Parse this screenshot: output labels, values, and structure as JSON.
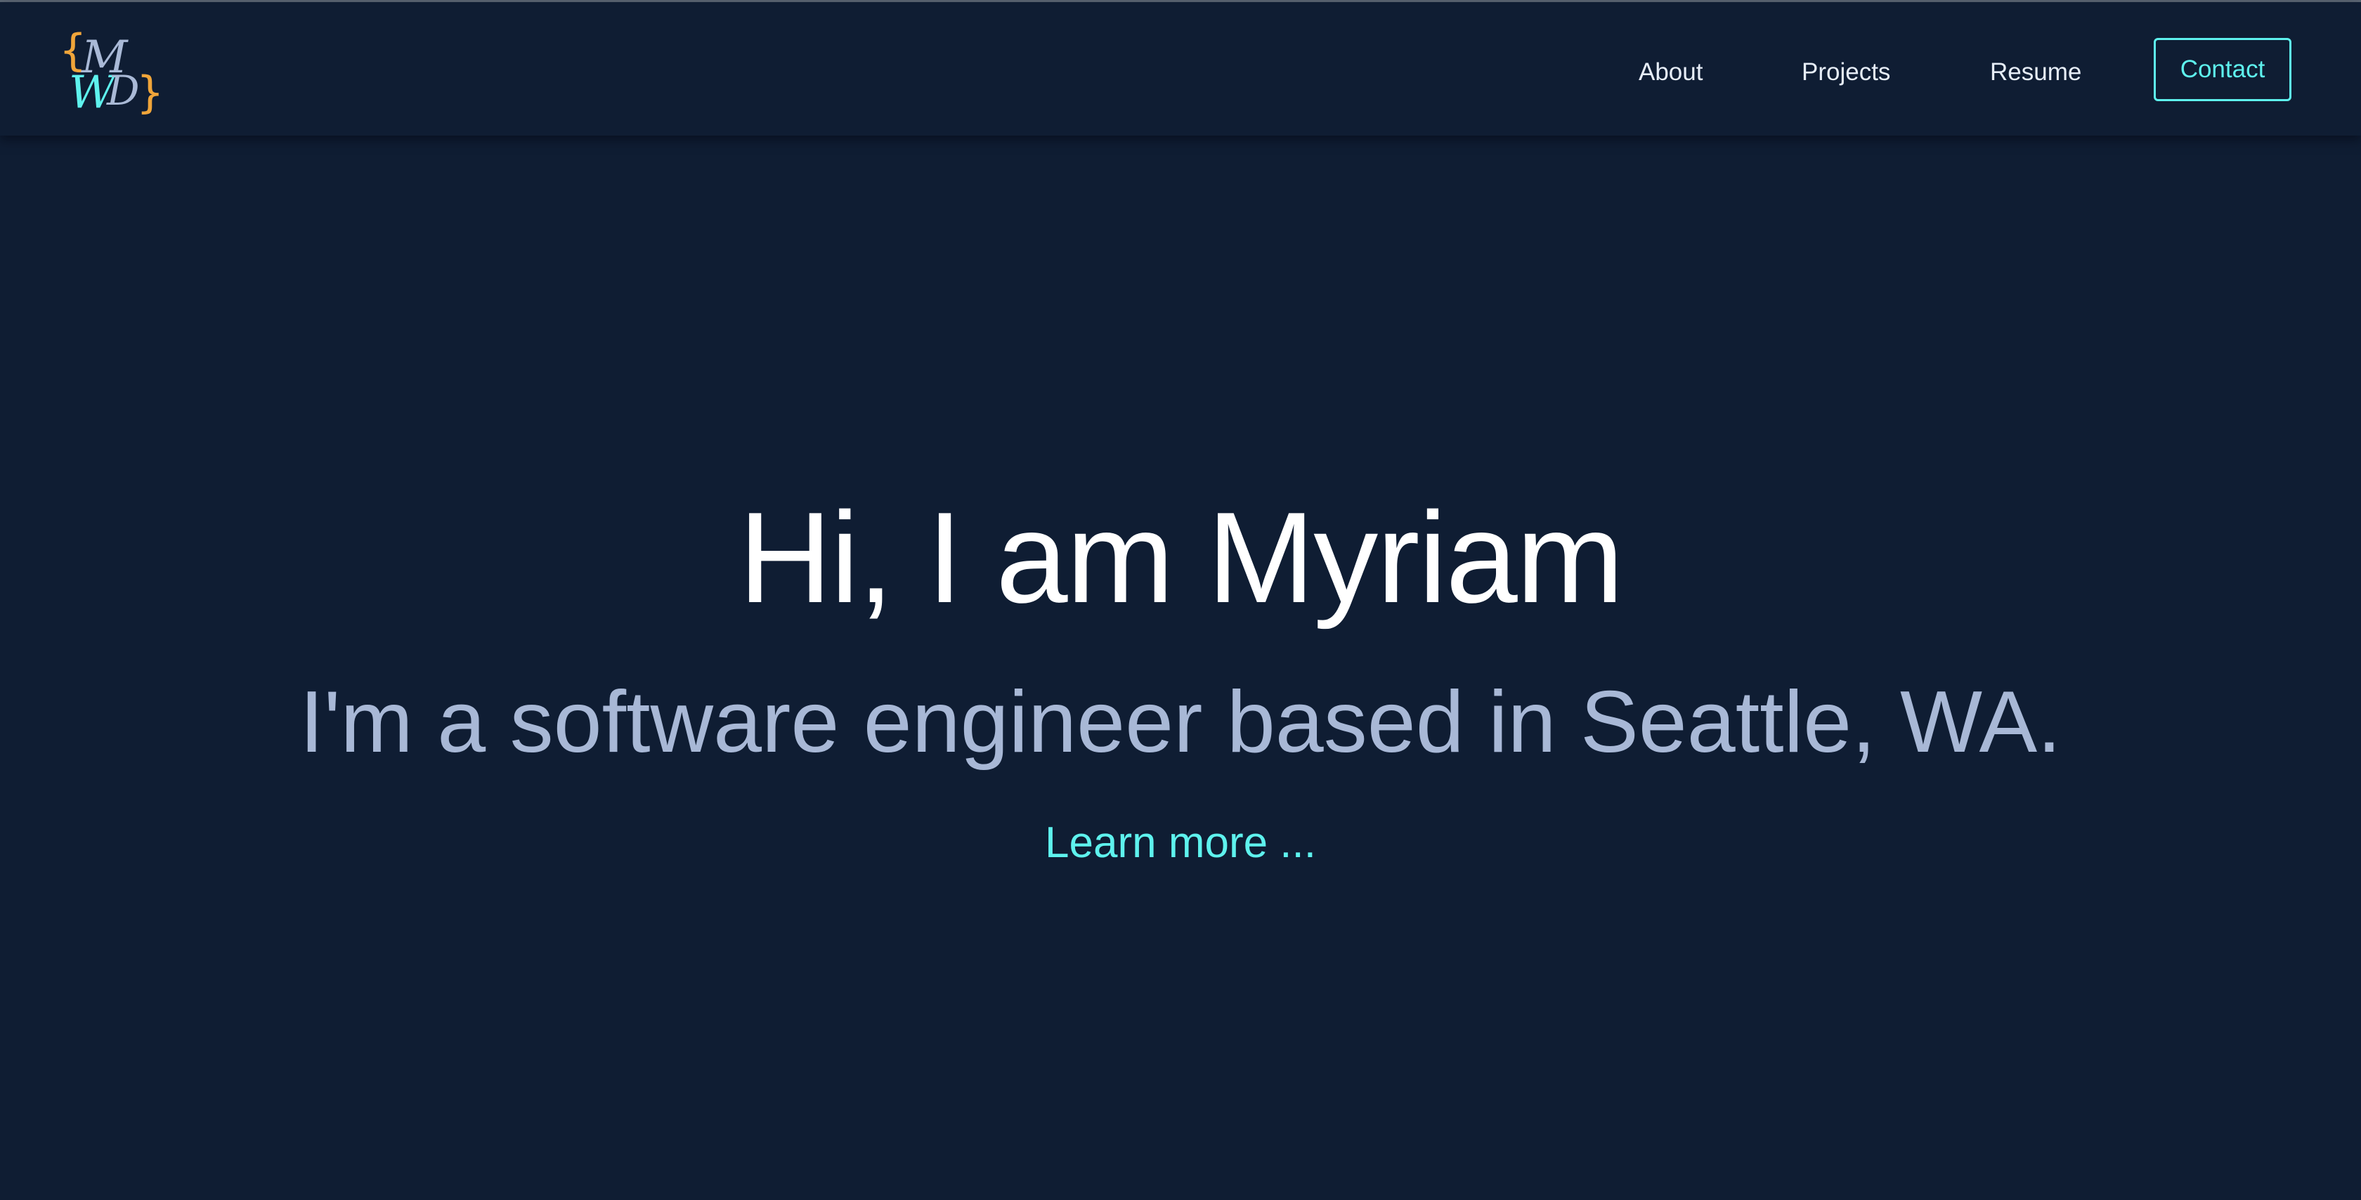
{
  "logo": {
    "left_brace": "{",
    "right_brace": "}",
    "letter_top": "M",
    "letter_bottom_left": "W",
    "letter_bottom_right": "D"
  },
  "nav": {
    "items": [
      {
        "label": "About"
      },
      {
        "label": "Projects"
      },
      {
        "label": "Resume"
      }
    ],
    "contact_label": "Contact"
  },
  "hero": {
    "title": "Hi, I am Myriam",
    "subtitle": "I'm a software engineer based in Seattle, WA.",
    "link": "Learn more ..."
  },
  "colors": {
    "background": "#0f1d33",
    "accent": "#5ef2ee",
    "subtitle": "#a8b8d6",
    "logo_brace": "#f0a53a",
    "logo_letter_top": "#a9b9d6",
    "logo_letter_bottom": "#5ef2ee"
  }
}
